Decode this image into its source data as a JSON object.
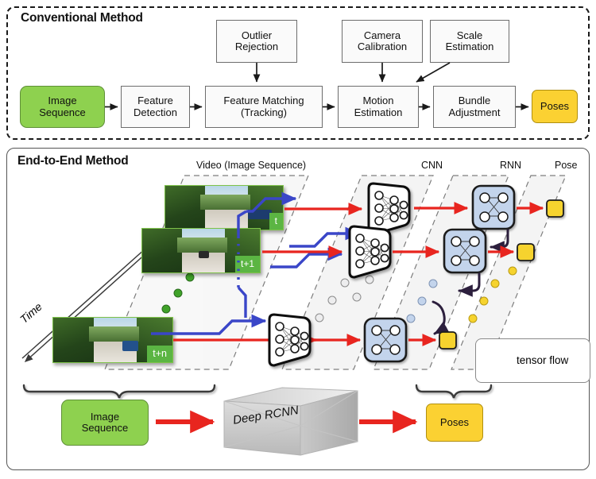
{
  "conventional": {
    "title": "Conventional Method",
    "top_boxes": [
      {
        "label": "Outlier\nRejection"
      },
      {
        "label": "Camera\nCalibration"
      },
      {
        "label": "Scale\nEstimation"
      }
    ],
    "pipeline": [
      {
        "label": "Image\nSequence",
        "style": "green"
      },
      {
        "label": "Feature\nDetection",
        "style": "plain"
      },
      {
        "label": "Feature Matching\n(Tracking)",
        "style": "plain"
      },
      {
        "label": "Motion\nEstimation",
        "style": "plain"
      },
      {
        "label": "Bundle\nAdjustment",
        "style": "plain"
      },
      {
        "label": "Poses",
        "style": "yellow"
      }
    ]
  },
  "endtoend": {
    "title": "End-to-End Method",
    "time_axis_label": "Time",
    "lane_labels": [
      {
        "name": "video",
        "text": "Video (Image Sequence)"
      },
      {
        "name": "cnn",
        "text": "CNN"
      },
      {
        "name": "rnn",
        "text": "RNN"
      },
      {
        "name": "pose",
        "text": "Pose"
      }
    ],
    "frames": [
      {
        "tag": "t"
      },
      {
        "tag": "t+1"
      },
      {
        "tag": "t+n"
      }
    ],
    "legend": {
      "label": "tensor flow",
      "arrow_colors": [
        "#e8251f",
        "#3a46c8",
        "#2c1f3d"
      ]
    },
    "summary": {
      "input_label": "Image\nSequence",
      "model_label": "Deep RCNN",
      "output_label": "Poses"
    },
    "dot_colors": {
      "video": "#3fa229",
      "cnn": "#e9e9ea",
      "rnn": "#c3d4ec",
      "pose": "#f6d32e"
    }
  },
  "colors": {
    "green": "#8ed14f",
    "yellow": "#fbd132",
    "red_arrow": "#e8251f",
    "blue_arrow": "#3a46c8",
    "dark_arrow": "#2c1f3d",
    "rnn_fill": "#c3d4ec",
    "box_stroke": "#6d6d6d"
  }
}
